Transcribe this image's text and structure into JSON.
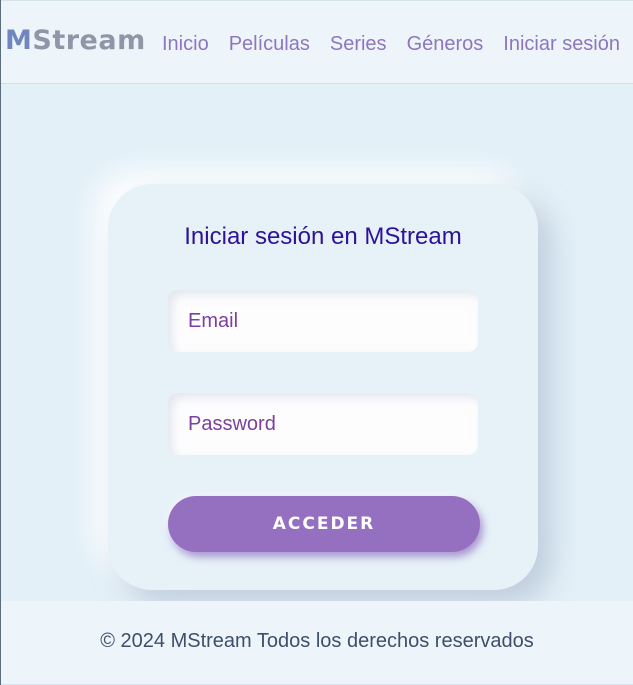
{
  "brand": {
    "first_letter": "M",
    "rest": "Stream"
  },
  "nav": {
    "items": [
      {
        "label": "Inicio"
      },
      {
        "label": "Películas"
      },
      {
        "label": "Series"
      },
      {
        "label": "Géneros"
      },
      {
        "label": "Iniciar sesión"
      }
    ]
  },
  "login": {
    "title": "Iniciar sesión en MStream",
    "email_placeholder": "Email",
    "email_value": "",
    "password_placeholder": "Password",
    "password_value": "",
    "submit_label": "ACCEDER"
  },
  "footer": {
    "text": "© 2024 MStream Todos los derechos reservados"
  },
  "colors": {
    "brand_accent": "#6f86bf",
    "nav_link": "#8e76be",
    "title": "#2d1299",
    "button": "#9570c1",
    "background": "#e3f0f8"
  }
}
